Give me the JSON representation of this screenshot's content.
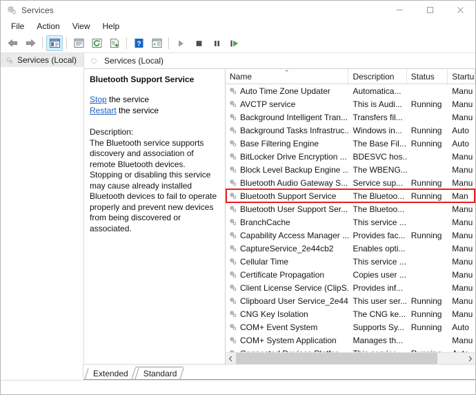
{
  "window": {
    "title": "Services",
    "icon": "services-gear-icon",
    "controls": {
      "minimize": "minimize-icon",
      "maximize": "maximize-icon",
      "close": "close-icon"
    }
  },
  "menubar": {
    "items": [
      {
        "label": "File"
      },
      {
        "label": "Action"
      },
      {
        "label": "View"
      },
      {
        "label": "Help"
      }
    ]
  },
  "toolbar": {
    "buttons": [
      {
        "name": "back-arrow-icon",
        "title": "Back"
      },
      {
        "name": "forward-arrow-icon",
        "title": "Forward"
      },
      {
        "name": "show-hide-console-tree-icon",
        "title": "Show/Hide Console Tree",
        "selected": true
      },
      {
        "name": "properties-icon",
        "title": "Properties"
      },
      {
        "name": "refresh-icon",
        "title": "Refresh"
      },
      {
        "name": "export-list-icon",
        "title": "Export List"
      },
      {
        "name": "help-icon",
        "title": "Help"
      },
      {
        "name": "show-hide-action-pane-icon",
        "title": "Show/Hide Action Pane"
      },
      {
        "name": "start-service-icon",
        "title": "Start Service"
      },
      {
        "name": "stop-service-icon",
        "title": "Stop Service"
      },
      {
        "name": "pause-service-icon",
        "title": "Pause Service"
      },
      {
        "name": "restart-service-icon",
        "title": "Restart Service"
      }
    ]
  },
  "tree": {
    "root_label": "Services (Local)"
  },
  "content_header": {
    "label": "Services (Local)"
  },
  "details": {
    "title": "Bluetooth Support Service",
    "links": [
      {
        "link_text": "Stop",
        "rest_text": " the service"
      },
      {
        "link_text": "Restart",
        "rest_text": " the service"
      }
    ],
    "description_label": "Description:",
    "description_text": "The Bluetooth service supports discovery and association of remote Bluetooth devices.  Stopping or disabling this service may cause already installed Bluetooth devices to fail to operate properly and prevent new devices from being discovered or associated."
  },
  "list": {
    "columns": [
      {
        "key": "name",
        "label": "Name",
        "sorted": true,
        "sort_dir": "asc"
      },
      {
        "key": "description",
        "label": "Description"
      },
      {
        "key": "status",
        "label": "Status"
      },
      {
        "key": "startup",
        "label": "Startu"
      }
    ],
    "rows": [
      {
        "name": "Auto Time Zone Updater",
        "description": "Automatica...",
        "status": "",
        "startup": "Manu"
      },
      {
        "name": "AVCTP service",
        "description": "This is Audi...",
        "status": "Running",
        "startup": "Manu"
      },
      {
        "name": "Background Intelligent Tran...",
        "description": "Transfers fil...",
        "status": "",
        "startup": "Manu"
      },
      {
        "name": "Background Tasks Infrastruc...",
        "description": "Windows in...",
        "status": "Running",
        "startup": "Auto"
      },
      {
        "name": "Base Filtering Engine",
        "description": "The Base Fil...",
        "status": "Running",
        "startup": "Auto"
      },
      {
        "name": "BitLocker Drive Encryption ...",
        "description": "BDESVC hos...",
        "status": "",
        "startup": "Manu"
      },
      {
        "name": "Block Level Backup Engine ...",
        "description": "The WBENG...",
        "status": "",
        "startup": "Manu"
      },
      {
        "name": "Bluetooth Audio Gateway S...",
        "description": "Service sup...",
        "status": "Running",
        "startup": "Manu"
      },
      {
        "name": "Bluetooth Support Service",
        "description": "The Bluetoo...",
        "status": "Running",
        "startup": "Man",
        "highlighted": true
      },
      {
        "name": "Bluetooth User Support Ser...",
        "description": "The Bluetoo...",
        "status": "",
        "startup": "Manu"
      },
      {
        "name": "BranchCache",
        "description": "This service ...",
        "status": "",
        "startup": "Manu"
      },
      {
        "name": "Capability Access Manager ...",
        "description": "Provides fac...",
        "status": "Running",
        "startup": "Manu"
      },
      {
        "name": "CaptureService_2e44cb2",
        "description": "Enables opti...",
        "status": "",
        "startup": "Manu"
      },
      {
        "name": "Cellular Time",
        "description": "This service ...",
        "status": "",
        "startup": "Manu"
      },
      {
        "name": "Certificate Propagation",
        "description": "Copies user ...",
        "status": "",
        "startup": "Manu"
      },
      {
        "name": "Client License Service (ClipS...",
        "description": "Provides inf...",
        "status": "",
        "startup": "Manu"
      },
      {
        "name": "Clipboard User Service_2e44...",
        "description": "This user ser...",
        "status": "Running",
        "startup": "Manu"
      },
      {
        "name": "CNG Key Isolation",
        "description": "The CNG ke...",
        "status": "Running",
        "startup": "Manu"
      },
      {
        "name": "COM+ Event System",
        "description": "Supports Sy...",
        "status": "Running",
        "startup": "Auto"
      },
      {
        "name": "COM+ System Application",
        "description": "Manages th...",
        "status": "",
        "startup": "Manu"
      },
      {
        "name": "Connected Devices Platfor...",
        "description": "This service ...",
        "status": "Running",
        "startup": "Auto"
      }
    ],
    "scrollbar": {
      "left_arrow": "chevron-left-icon",
      "right_arrow": "chevron-right-icon"
    }
  },
  "tabs": [
    {
      "label": "Extended",
      "active": false
    },
    {
      "label": "Standard",
      "active": true
    }
  ],
  "colors": {
    "highlight_box": "#ee1b1b",
    "link": "#1b5fbe",
    "selected_toolbar": "#d7eefc",
    "tree_node_bg": "#eaeaea"
  }
}
